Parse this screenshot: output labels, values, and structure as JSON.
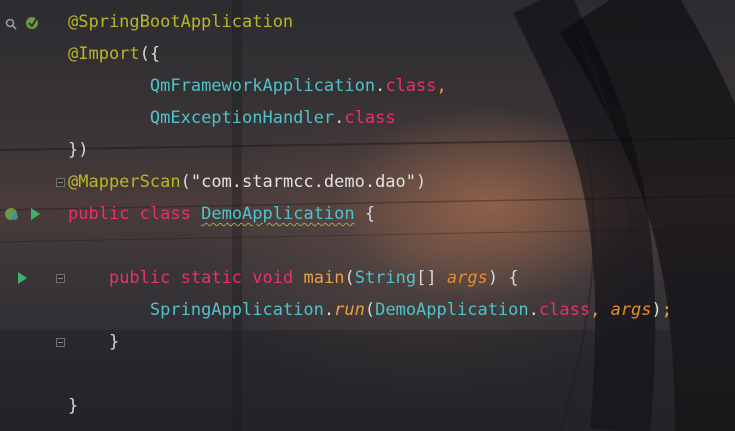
{
  "lines": {
    "l1": {
      "annotation": "@SpringBootApplication"
    },
    "l2": {
      "annotation": "@Import",
      "open": "({"
    },
    "l3": {
      "class_name": "QmFrameworkApplication",
      "dot": ".",
      "class_kw": "class",
      "comma": ","
    },
    "l4": {
      "class_name": "QmExceptionHandler",
      "dot": ".",
      "class_kw": "class"
    },
    "l5": {
      "close": "})"
    },
    "l6": {
      "annotation": "@MapperScan",
      "open": "(",
      "string": "\"com.starmcc.demo.dao\"",
      "close": ")"
    },
    "l7": {
      "kw_public": "public",
      "kw_class": "class",
      "class_name": "DemoApplication",
      "brace": "{"
    },
    "l9": {
      "kw_public": "public",
      "kw_static": "static",
      "kw_void": "void",
      "method": "main",
      "open": "(",
      "type": "String",
      "array": "[]",
      "param": "args",
      "close": ")",
      "brace": "{"
    },
    "l10": {
      "class_name": "SpringApplication",
      "dot": ".",
      "method": "run",
      "open": "(",
      "arg_class": "DemoApplication",
      "dot2": ".",
      "class_kw": "class",
      "comma": ",",
      "param": "args",
      "close": ")",
      "semi": ";"
    },
    "l11": {
      "brace": "}"
    },
    "l13": {
      "brace": "}"
    }
  },
  "gutter_icons": {
    "spring_bean_icon": "spring-leaf-icon",
    "bean_search_icon": "bean-search-icon",
    "run_icon": "run-arrow-icon",
    "fold_icon": "fold-marker-icon"
  },
  "colors": {
    "annotation": "#bbb529",
    "keyword": "#e8316a",
    "class": "#4fc3c9",
    "method": "#e8a047",
    "parameter": "#e88a2a",
    "run_arrow": "#3cb36a"
  }
}
